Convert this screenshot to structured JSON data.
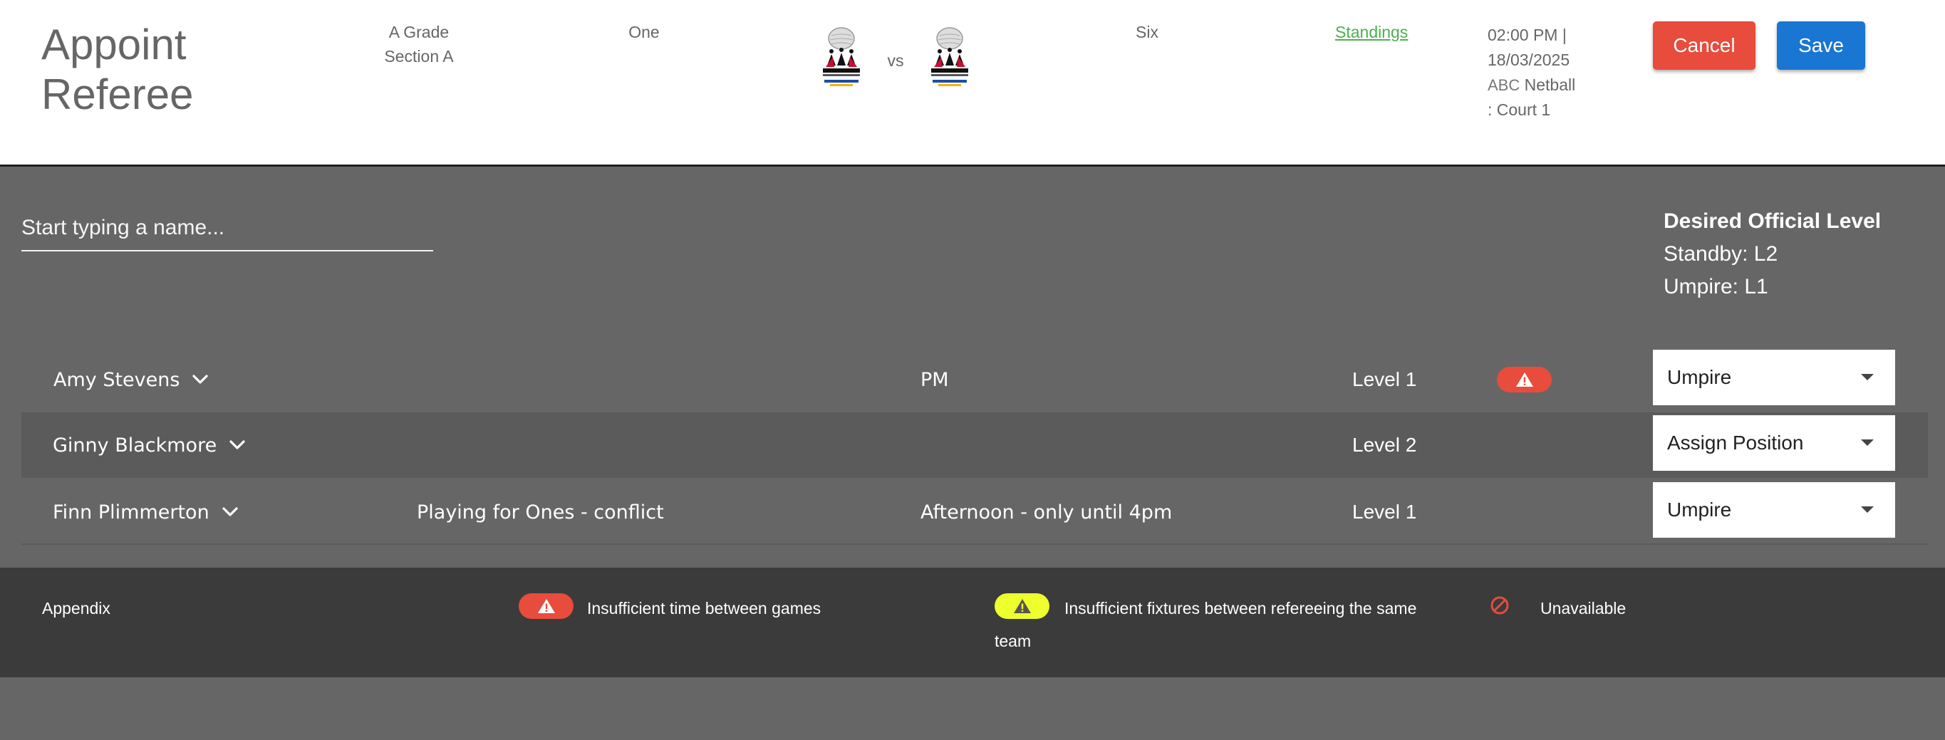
{
  "header": {
    "title": "Appoint Referee",
    "grade_line1": "A Grade",
    "grade_line2": "Section A",
    "round": "One",
    "vs": "vs",
    "division": "Six",
    "standings_link": "Standings",
    "time": "02:00 PM |",
    "date": "18/03/2025",
    "venue_abbr": "ABC",
    "venue": "Netball",
    "court": ": Court  1",
    "cancel_label": "Cancel",
    "save_label": "Save"
  },
  "search": {
    "placeholder": "Start typing a name..."
  },
  "desired_level": {
    "title": "Desired Official Level",
    "standby": "Standby: L2",
    "umpire": "Umpire: L1"
  },
  "referees": [
    {
      "name": "Amy Stevens",
      "note": "",
      "availability": "PM",
      "level": "Level 1",
      "warning": "insufficient-time",
      "position": "Umpire"
    },
    {
      "name": "Ginny Blackmore",
      "note": "",
      "availability": "",
      "level": "Level 2",
      "warning": "",
      "position": "Assign Position"
    },
    {
      "name": "Finn Plimmerton",
      "note": "Playing for Ones - conflict",
      "availability": "Afternoon - only until 4pm",
      "level": "Level 1",
      "warning": "",
      "position": "Umpire"
    }
  ],
  "appendix": {
    "title": "Appendix",
    "item1": "Insufficient time between games",
    "item2_line1": "Insufficient fixtures between refereeing the same",
    "item2_line2": "team",
    "item3": "Unavailable"
  },
  "colors": {
    "danger": "#e74c3c",
    "primary": "#1976d2",
    "warning": "#eeff2e",
    "link": "#4caf50"
  },
  "icons": {
    "logo": "netball-logo",
    "warning": "warning-triangle-icon",
    "unavailable": "unavailable-icon",
    "expand": "chevron-down-icon",
    "dropdown": "caret-down-icon"
  }
}
